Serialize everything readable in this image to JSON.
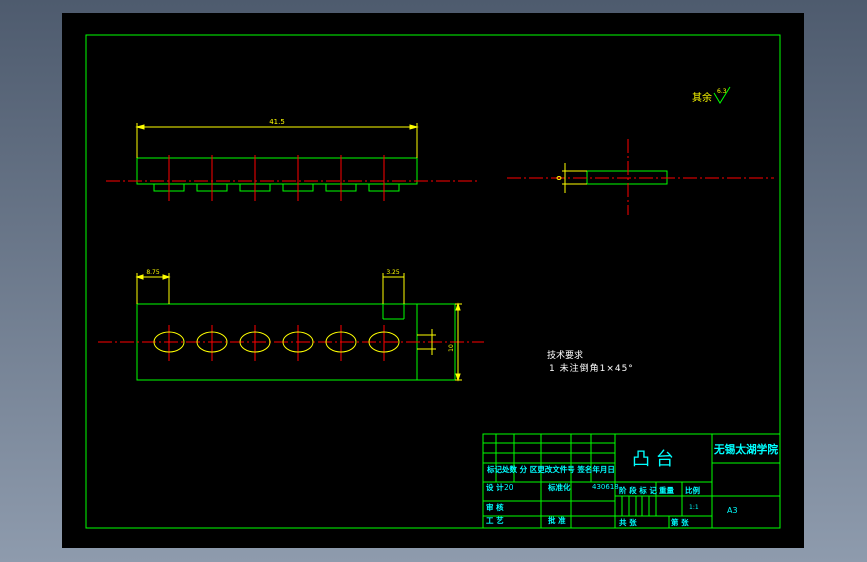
{
  "drawing": {
    "roughness_symbol": "其余",
    "roughness_value": "6.3",
    "dimensions": {
      "overall_length": "41.5",
      "left_offset": "8.75",
      "slot_width": "3.25",
      "height": "10"
    },
    "tech_requirements": {
      "title": "技术要求",
      "item1": "1 未注倒角1×45°"
    }
  },
  "title_block": {
    "part_name": "凸  台",
    "school": "无锡太湖学院",
    "row_labels": "标记处数 分 区更改文件号 签名年月日",
    "designer_label": "设 计",
    "designer_value": "20",
    "standardize": "标准化",
    "drawing_no": "430618",
    "stage_label": "阶 段 标 记",
    "weight_label": "重量",
    "scale_label": "比例",
    "scale_value": "1:1",
    "review_label": "审 核",
    "process_label": "工 艺",
    "approve_label": "批 准",
    "sheets_label": "共  张",
    "sheet_no_label": "第  张",
    "format": "A3"
  },
  "colors": {
    "background": "#000000",
    "outline": "#00ff00",
    "center_line": "#ff0000",
    "dimension": "#ffff00",
    "text": "#00ffff"
  }
}
